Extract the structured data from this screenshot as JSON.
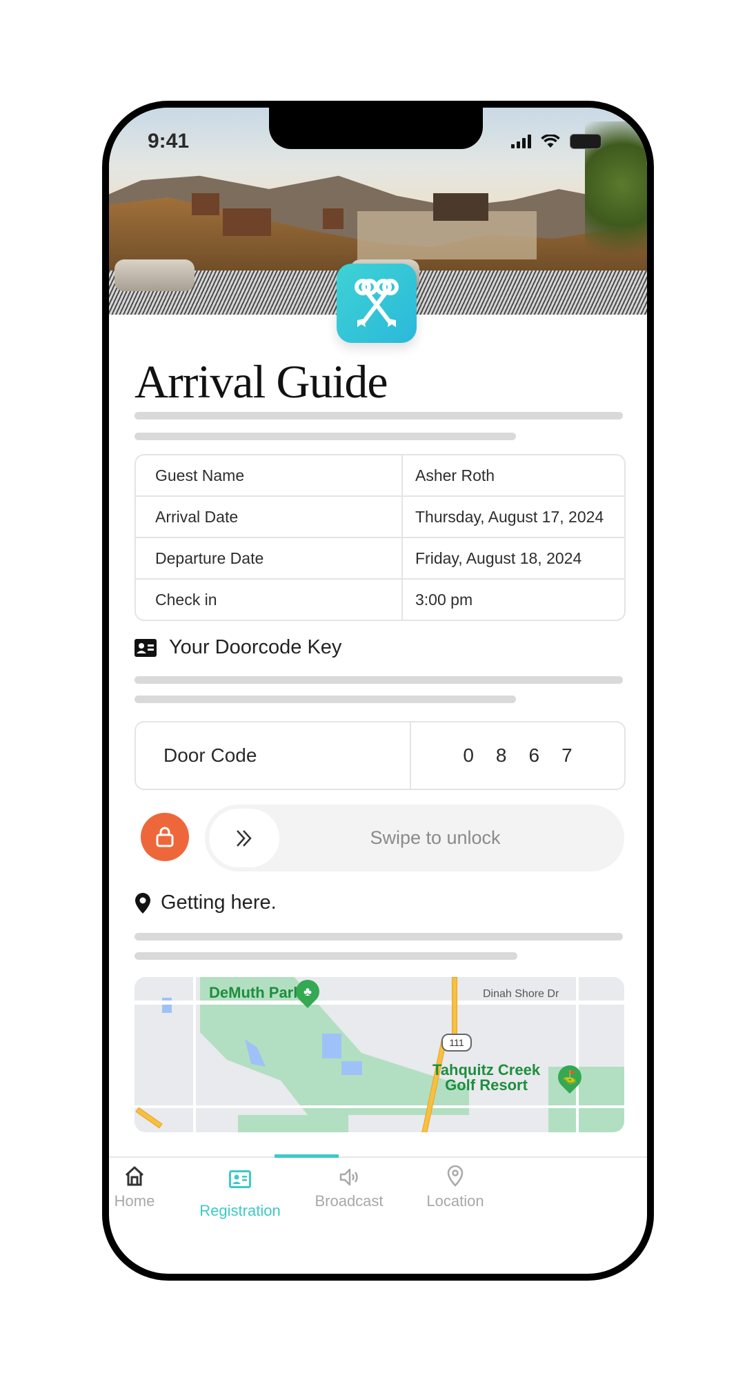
{
  "status_bar": {
    "time": "9:41"
  },
  "header": {
    "title": "Arrival Guide",
    "logo_icon": "crossed-keys-icon"
  },
  "guest_info": {
    "rows": [
      {
        "label": "Guest Name",
        "value": "Asher Roth"
      },
      {
        "label": "Arrival Date",
        "value": "Thursday, August 17, 2024"
      },
      {
        "label": "Departure Date",
        "value": "Friday, August 18, 2024"
      },
      {
        "label": "Check in",
        "value": "3:00 pm"
      }
    ]
  },
  "doorcode": {
    "heading": "Your Doorcode Key",
    "icon": "id-card-icon",
    "label": "Door Code",
    "digits": [
      "0",
      "8",
      "6",
      "7"
    ]
  },
  "unlock": {
    "lock_icon": "lock-icon",
    "knob_icon": "double-chevron-right-icon",
    "label": "Swipe to unlock"
  },
  "getting_here": {
    "heading": "Getting here.",
    "icon": "map-pin-icon",
    "map": {
      "park_label": "DeMuth Park",
      "street_label": "Dinah Shore Dr",
      "highway_label": "111",
      "golf_label_line1": "Tahquitz Creek",
      "golf_label_line2": "Golf Resort"
    }
  },
  "tabs": [
    {
      "label": "Home",
      "icon": "home-icon",
      "active": false
    },
    {
      "label": "Registration",
      "icon": "id-card-icon",
      "active": true
    },
    {
      "label": "Broadcast",
      "icon": "speaker-icon",
      "active": false
    },
    {
      "label": "Location",
      "icon": "location-pin-icon",
      "active": false
    }
  ],
  "colors": {
    "accent": "#3cc9c9",
    "lock_button": "#ee673b",
    "logo_gradient_start": "#3fd2d4",
    "logo_gradient_end": "#2ab9db"
  }
}
